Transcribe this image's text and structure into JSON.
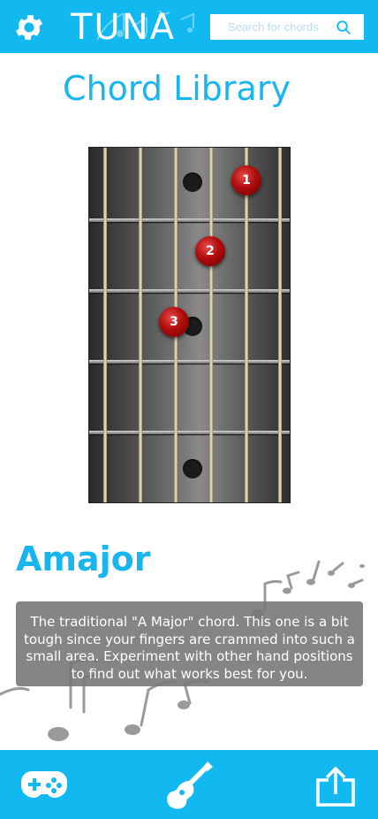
{
  "header": {
    "brand": "TUNA",
    "search_placeholder": "Search for chords"
  },
  "page_title": "Chord Library",
  "chord": {
    "name": "Amajor",
    "description": "The traditional \"A Major\" chord. This one is a bit tough since your fingers are crammed into such a small area. Experiment with other hand positions to find out what works best for you.",
    "fingers": [
      "1",
      "2",
      "3"
    ]
  },
  "colors": {
    "accent": "#12b8f0",
    "title": "#18b5ee",
    "finger": "#b00d0d"
  },
  "icons": {
    "settings": "gear-icon",
    "search": "search-icon",
    "games": "gamepad-icon",
    "chords": "guitar-icon",
    "share": "share-icon"
  }
}
